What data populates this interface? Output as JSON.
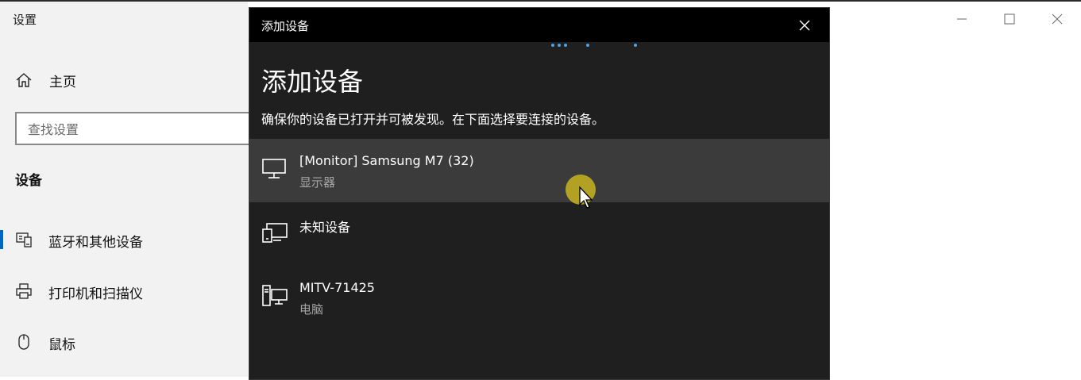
{
  "settings": {
    "window_title": "设置",
    "home_label": "主页",
    "search_placeholder": "查找设置",
    "section_title": "设备",
    "nav_items": [
      {
        "label": "蓝牙和其他设备",
        "icon": "bluetooth-devices-icon",
        "selected": true
      },
      {
        "label": "打印机和扫描仪",
        "icon": "printer-icon",
        "selected": false
      },
      {
        "label": "鼠标",
        "icon": "mouse-icon",
        "selected": false
      }
    ]
  },
  "dialog": {
    "title": "添加设备",
    "heading": "添加设备",
    "subtitle": "确保你的设备已打开并可被发现。在下面选择要连接的设备。",
    "devices": [
      {
        "name": "[Monitor] Samsung M7 (32)",
        "type": "显示器",
        "icon": "monitor-icon"
      },
      {
        "name": "未知设备",
        "type": "",
        "icon": "unknown-device-icon"
      },
      {
        "name": "MITV-71425",
        "type": "电脑",
        "icon": "computer-icon"
      }
    ]
  },
  "colors": {
    "accent": "#0067c0",
    "dialog_bg": "#1f1f1f",
    "titlebar_bg": "#000000",
    "hover_bg": "#3b3b3b",
    "progress_dots": "#4aa3ea",
    "cursor_highlight": "#c8b41e"
  }
}
